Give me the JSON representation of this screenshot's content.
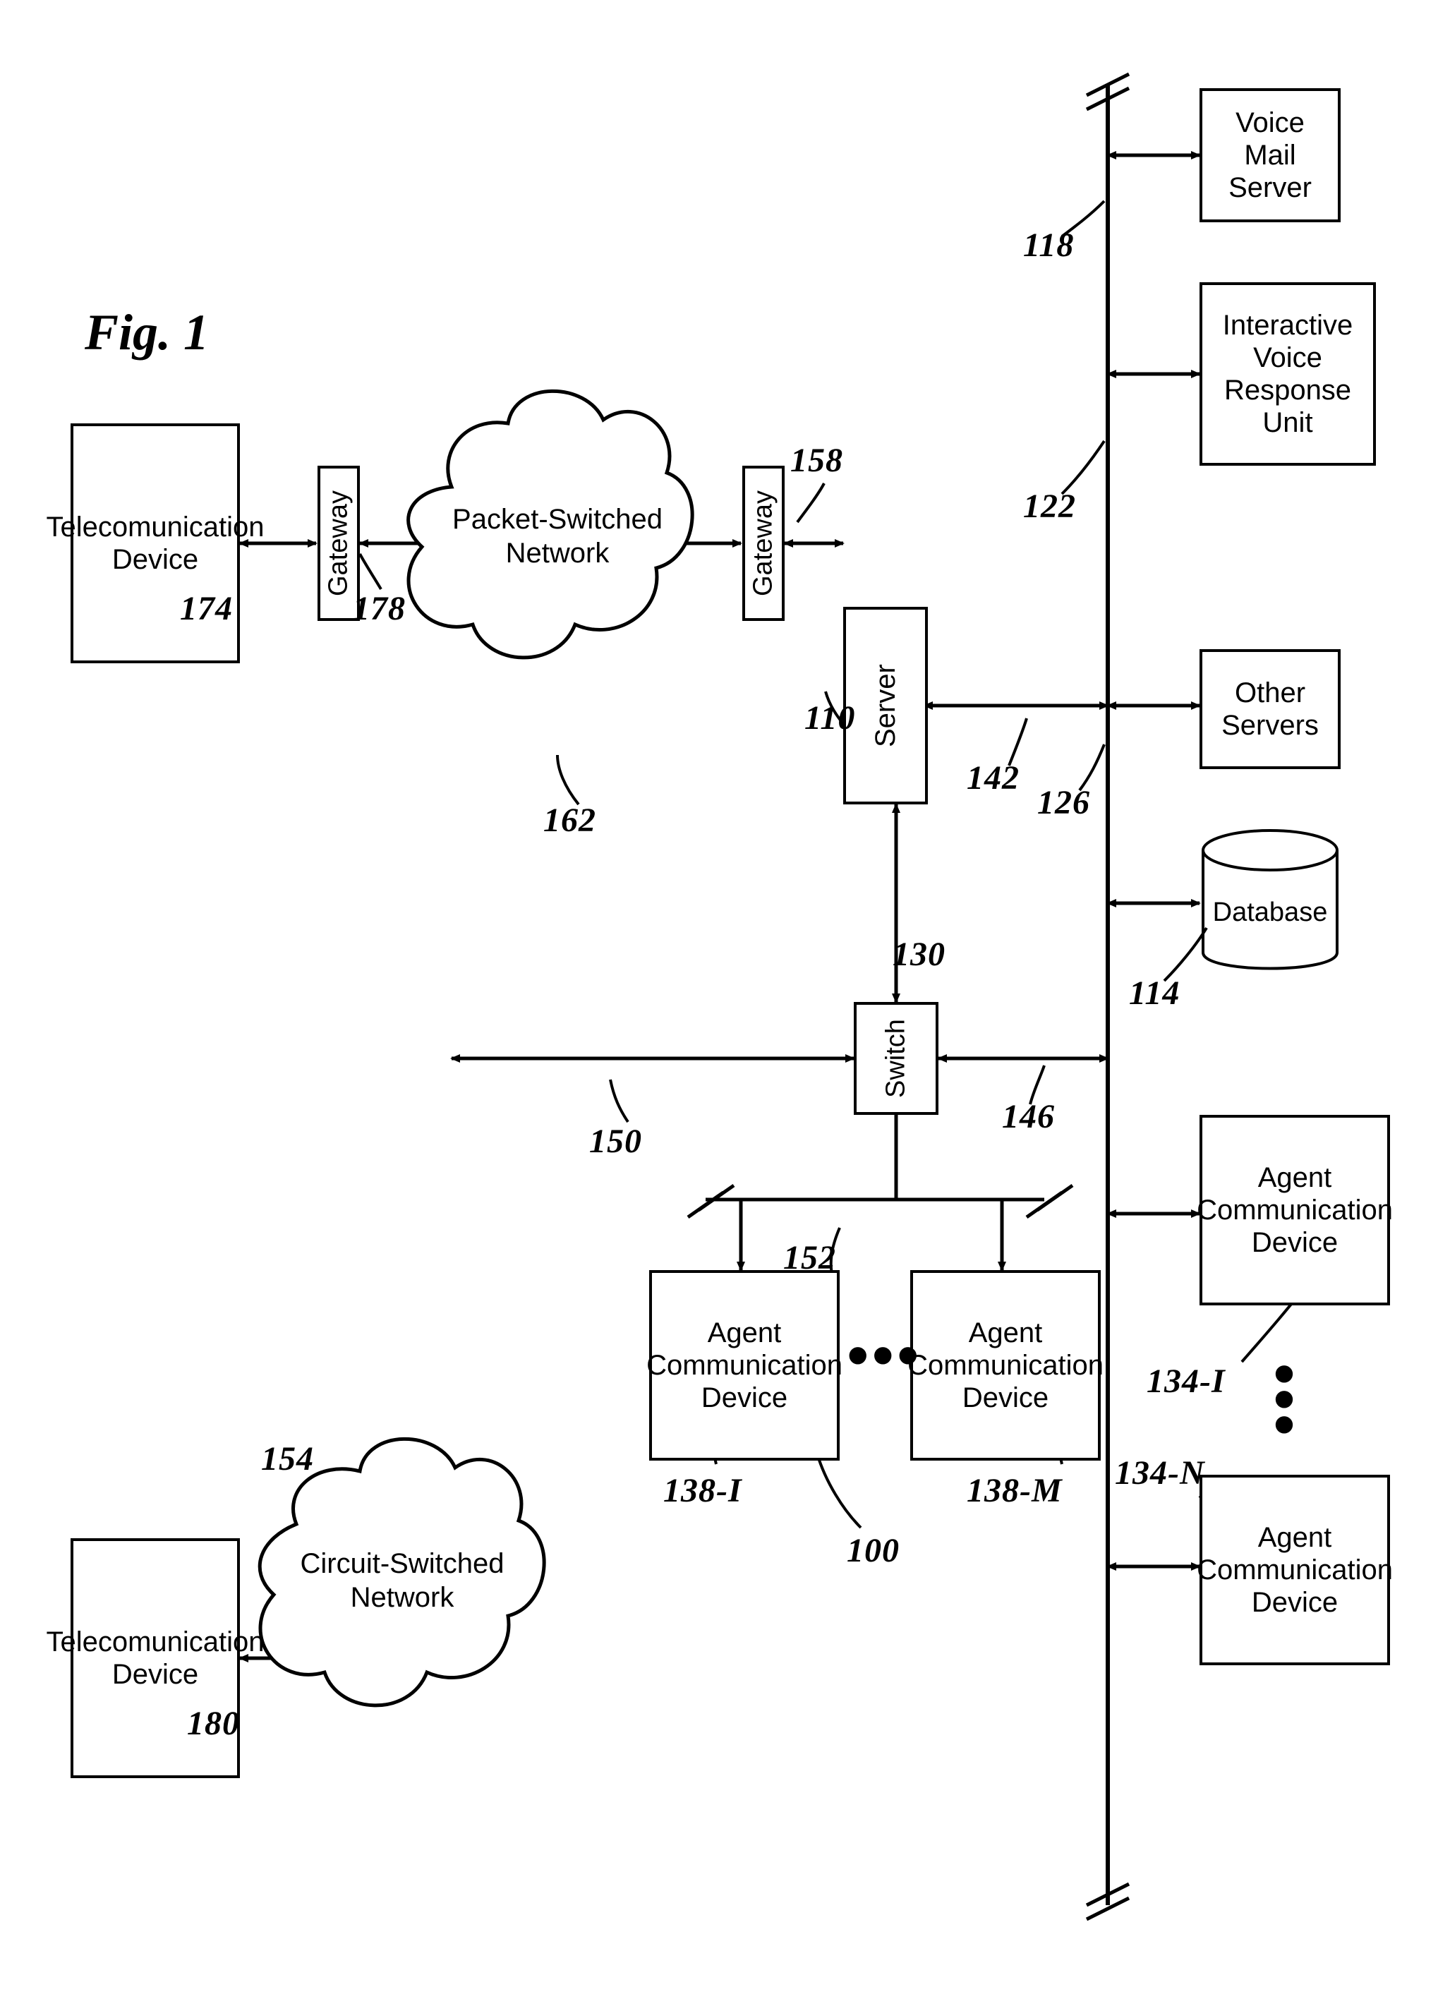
{
  "figure_title": "Fig. 1",
  "refs": {
    "r100": "100",
    "r110": "110",
    "r114": "114",
    "r118": "118",
    "r122": "122",
    "r126": "126",
    "r130": "130",
    "r134I": "134-I",
    "r134N": "134-N",
    "r138I": "138-I",
    "r138M": "138-M",
    "r142": "142",
    "r146": "146",
    "r150": "150",
    "r152": "152",
    "r154": "154",
    "r158": "158",
    "r162": "162",
    "r174": "174",
    "r178": "178",
    "r180": "180"
  },
  "labels": {
    "telecom1": "Telecomunication Device",
    "telecom2": "Telecomunication Device",
    "gateway1": "Gateway",
    "gateway2": "Gateway",
    "pktnet": "Packet-Switched Network",
    "cktnet": "Circuit-Switched Network",
    "server": "Server",
    "switch": "Switch",
    "voicemail": "Voice Mail Server",
    "ivr": "Interactive Voice Response Unit",
    "otherservers": "Other Servers",
    "database": "Database",
    "agent134I": "Agent Communication Device",
    "agent134N": "Agent Communication Device",
    "agent138I": "Agent Communication Device",
    "agent138M": "Agent Communication Device"
  }
}
